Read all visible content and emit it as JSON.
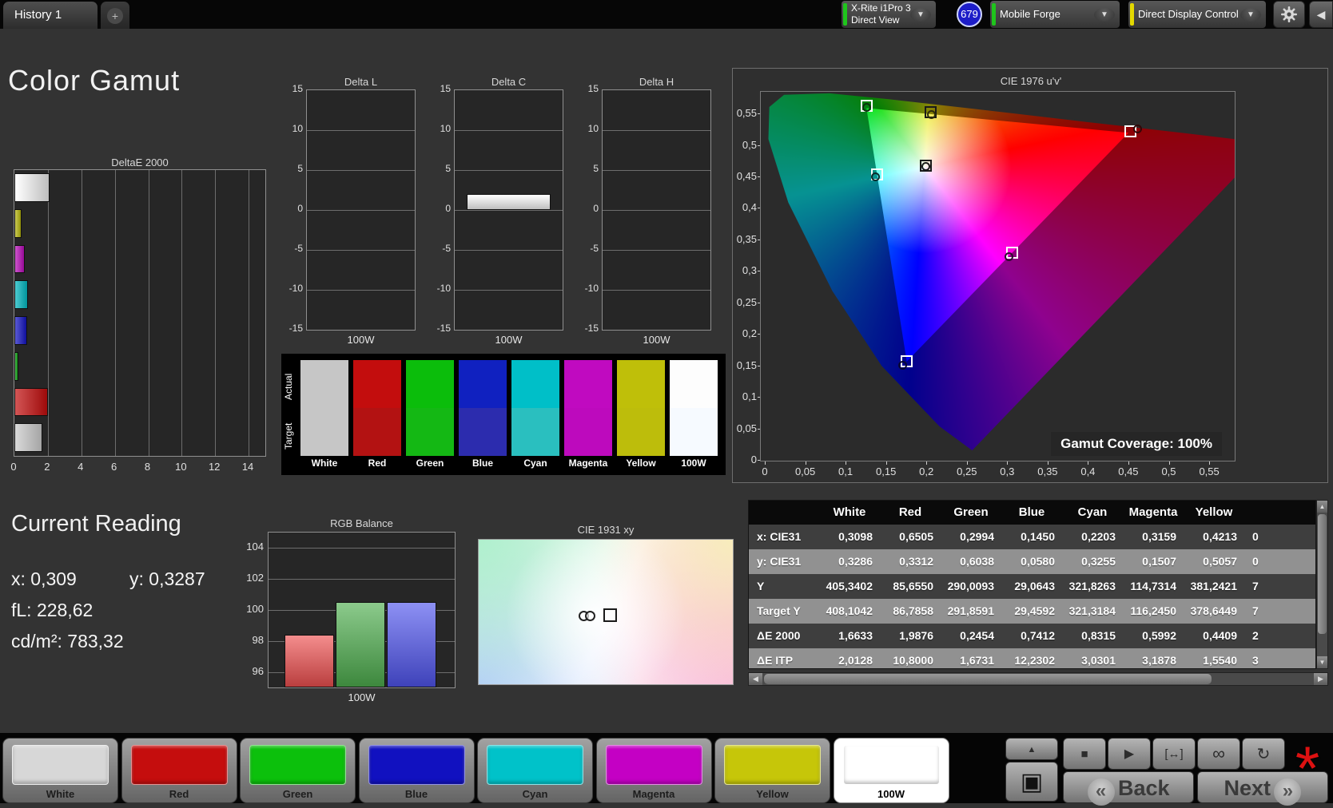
{
  "window": {
    "tab_label": "History 1",
    "add_tab_label": "+",
    "meter_dropdown": {
      "line1": "X-Rite i1Pro 3",
      "line2": "Direct View",
      "status_color": "#1fc51c"
    },
    "reads_badge": "679",
    "source_dropdown": {
      "label": "Mobile Forge",
      "status_color": "#1fc51c"
    },
    "control_dropdown": {
      "label": "Direct Display Control",
      "status_color": "#e3d800"
    }
  },
  "page": {
    "title": "Color Gamut"
  },
  "current_reading": {
    "title": "Current Reading",
    "x": "x: 0,309",
    "y": "y: 0,3287",
    "fl": "fL: 228,62",
    "cd": "cd/m²: 783,32"
  },
  "swatch_compare": {
    "row_labels": [
      "Actual",
      "Target"
    ],
    "columns": [
      {
        "label": "White",
        "actual": "#c6c6c6",
        "target": "#c6c6c6"
      },
      {
        "label": "Red",
        "actual": "#c30d0d",
        "target": "#b31212"
      },
      {
        "label": "Green",
        "actual": "#0bbd0b",
        "target": "#14b814"
      },
      {
        "label": "Blue",
        "actual": "#1021c0",
        "target": "#2c2cae"
      },
      {
        "label": "Cyan",
        "actual": "#00bfc8",
        "target": "#2abfbf"
      },
      {
        "label": "Magenta",
        "actual": "#c00ac0",
        "target": "#bd0abd"
      },
      {
        "label": "Yellow",
        "actual": "#bfbf09",
        "target": "#bdbd0b"
      },
      {
        "label": "100W",
        "actual": "#fdfdfd",
        "target": "#f6faff"
      }
    ]
  },
  "chart_data": [
    {
      "id": "deltae2000",
      "type": "bar",
      "orientation": "horizontal",
      "title": "DeltaE 2000",
      "categories": [
        "100W",
        "Yellow",
        "Magenta",
        "Cyan",
        "Blue",
        "Green",
        "Red",
        "White"
      ],
      "values": [
        2.1,
        0.44,
        0.6,
        0.83,
        0.74,
        0.25,
        1.99,
        1.66
      ],
      "xlim": [
        0,
        15
      ],
      "xticks": [
        0,
        2,
        4,
        6,
        8,
        10,
        12,
        14
      ],
      "bar_colors": [
        "#f4f4f4",
        "#b5b50b",
        "#b80cb8",
        "#00b5be",
        "#1212c0",
        "#0da512",
        "#c00c0c",
        "#c9c9c9"
      ]
    },
    {
      "id": "delta_l",
      "type": "bar",
      "title": "Delta L",
      "categories": [
        "100W"
      ],
      "values": [
        0
      ],
      "ylim": [
        -15,
        15
      ],
      "yticks": [
        15,
        10,
        5,
        0,
        -5,
        -10,
        -15
      ],
      "xlabel": "100W"
    },
    {
      "id": "delta_c",
      "type": "bar",
      "title": "Delta C",
      "categories": [
        "100W"
      ],
      "values": [
        2.0
      ],
      "ylim": [
        -15,
        15
      ],
      "yticks": [
        15,
        10,
        5,
        0,
        -5,
        -10,
        -15
      ],
      "xlabel": "100W"
    },
    {
      "id": "delta_h",
      "type": "bar",
      "title": "Delta H",
      "categories": [
        "100W"
      ],
      "values": [
        0
      ],
      "ylim": [
        -15,
        15
      ],
      "yticks": [
        15,
        10,
        5,
        0,
        -5,
        -10,
        -15
      ],
      "xlabel": "100W"
    },
    {
      "id": "rgb_balance",
      "type": "bar",
      "title": "RGB Balance",
      "categories": [
        "Red",
        "Green",
        "Blue"
      ],
      "values": [
        98.4,
        100.5,
        100.5
      ],
      "ylim": [
        95,
        105
      ],
      "yticks": [
        104,
        102,
        100,
        98,
        96
      ],
      "xlabel": "100W",
      "bar_colors": [
        "#ee5050",
        "#4eae4e",
        "#5055ee"
      ]
    },
    {
      "id": "cie1976",
      "type": "scatter",
      "title": "CIE 1976 u'v'",
      "xlim": [
        0,
        0.588
      ],
      "ylim": [
        0,
        0.588
      ],
      "xticks": [
        "0",
        "0,05",
        "0,1",
        "0,15",
        "0,2",
        "0,25",
        "0,3",
        "0,35",
        "0,4",
        "0,45",
        "0,5",
        "0,55"
      ],
      "yticks": [
        "0,55",
        "0,5",
        "0,45",
        "0,4",
        "0,35",
        "0,3",
        "0,25",
        "0,2",
        "0,15",
        "0,1",
        "0,05",
        "0"
      ],
      "annotation": "Gamut Coverage:  100%",
      "points": [
        {
          "name": "White",
          "target_u": 0.198,
          "target_v": 0.468,
          "measured_u": 0.198,
          "measured_v": 0.467,
          "square_color": "#1a1a1a",
          "circle_color": "#1a1a1a"
        },
        {
          "name": "Red",
          "target_u": 0.451,
          "target_v": 0.523,
          "measured_u": 0.46,
          "measured_v": 0.527,
          "square_color": "#ffffff",
          "circle_color": "#330707"
        },
        {
          "name": "Green",
          "target_u": 0.125,
          "target_v": 0.563,
          "measured_u": 0.125,
          "measured_v": 0.561,
          "square_color": "#ffffff",
          "circle_color": "#0c330c"
        },
        {
          "name": "Blue",
          "target_u": 0.175,
          "target_v": 0.158,
          "measured_u": 0.17,
          "measured_v": 0.152,
          "square_color": "#ffffff",
          "circle_color": "#0a0a30"
        },
        {
          "name": "Cyan",
          "target_u": 0.138,
          "target_v": 0.455,
          "measured_u": 0.136,
          "measured_v": 0.45,
          "square_color": "#ffffff",
          "circle_color": "#0a2e2e"
        },
        {
          "name": "Magenta",
          "target_u": 0.305,
          "target_v": 0.33,
          "measured_u": 0.301,
          "measured_v": 0.324,
          "square_color": "#ffffff",
          "circle_color": "#2e0a2e"
        },
        {
          "name": "Yellow",
          "target_u": 0.204,
          "target_v": 0.553,
          "measured_u": 0.205,
          "measured_v": 0.549,
          "square_color": "#1a1a1a",
          "circle_color": "#2e2e0a"
        }
      ]
    },
    {
      "id": "cie1931",
      "type": "scatter",
      "title": "CIE 1931 xy",
      "points": [
        {
          "name": "measured",
          "rel_x": 0.425,
          "rel_y": 0.53
        },
        {
          "name": "target",
          "rel_x": 0.49,
          "rel_y": 0.52
        }
      ]
    },
    {
      "id": "results_table",
      "type": "table",
      "headers": [
        "",
        "White",
        "Red",
        "Green",
        "Blue",
        "Cyan",
        "Magenta",
        "Yellow"
      ],
      "partial_header": "",
      "rows": [
        {
          "label": "x: CIE31",
          "values": [
            "0,3098",
            "0,6505",
            "0,2994",
            "0,1450",
            "0,2203",
            "0,3159",
            "0,4213"
          ],
          "partial": "0"
        },
        {
          "label": "y: CIE31",
          "values": [
            "0,3286",
            "0,3312",
            "0,6038",
            "0,0580",
            "0,3255",
            "0,1507",
            "0,5057"
          ],
          "partial": "0"
        },
        {
          "label": "Y",
          "values": [
            "405,3402",
            "85,6550",
            "290,0093",
            "29,0643",
            "321,8263",
            "114,7314",
            "381,2421"
          ],
          "partial": "7"
        },
        {
          "label": "Target Y",
          "values": [
            "408,1042",
            "86,7858",
            "291,8591",
            "29,4592",
            "321,3184",
            "116,2450",
            "378,6449"
          ],
          "partial": "7"
        },
        {
          "label": "ΔE 2000",
          "values": [
            "1,6633",
            "1,9876",
            "0,2454",
            "0,7412",
            "0,8315",
            "0,5992",
            "0,4409"
          ],
          "partial": "2"
        },
        {
          "label": "ΔE ITP",
          "values": [
            "2,0128",
            "10,8000",
            "1,6731",
            "12,2302",
            "3,0301",
            "3,1878",
            "1,5540"
          ],
          "partial": "3"
        }
      ]
    }
  ],
  "bottom_bar": {
    "patterns": [
      {
        "label": "White",
        "color": "#d7d7d7",
        "selected": false
      },
      {
        "label": "Red",
        "color": "#c50d0d",
        "selected": false
      },
      {
        "label": "Green",
        "color": "#0cc00c",
        "selected": false
      },
      {
        "label": "Blue",
        "color": "#1111c0",
        "selected": false
      },
      {
        "label": "Cyan",
        "color": "#00c2c9",
        "selected": false
      },
      {
        "label": "Magenta",
        "color": "#c400c4",
        "selected": false
      },
      {
        "label": "Yellow",
        "color": "#c6c609",
        "selected": false
      },
      {
        "label": "100W",
        "color": "#ffffff",
        "selected": true
      }
    ],
    "controls": {
      "up": "▲",
      "pattern_window": "▣",
      "stop": "■",
      "play": "▶",
      "size": "[↔]",
      "loop": "∞",
      "repeat": "↻",
      "alert": "*",
      "back_chevron": "«",
      "back_label": "Back",
      "next_label": "Next",
      "next_chevron": "»"
    }
  }
}
